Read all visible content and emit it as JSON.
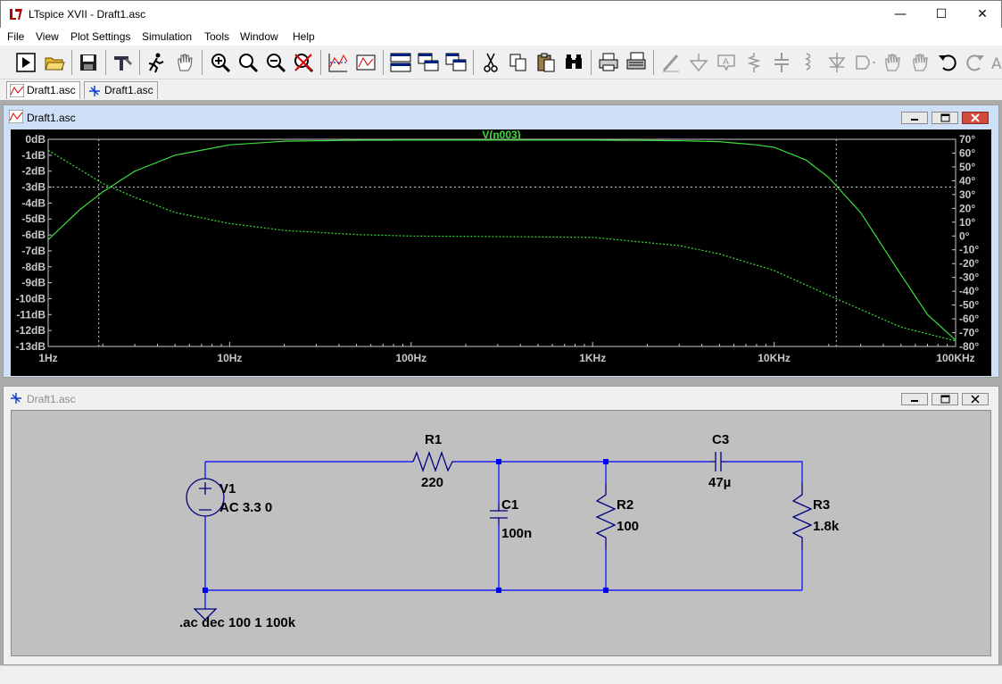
{
  "window": {
    "title": "LTspice XVII - Draft1.asc",
    "minimize_glyph": "—",
    "maximize_glyph": "☐",
    "close_glyph": "✕"
  },
  "menu": [
    "File",
    "View",
    "Plot Settings",
    "Simulation",
    "Tools",
    "Window",
    "Help"
  ],
  "toolbar_icons": [
    "run-icon",
    "open-icon",
    "save-icon",
    "control-panel-icon",
    "run-pause-icon",
    "pan-hand-icon",
    "zoom-in-icon",
    "zoom-fit-icon",
    "zoom-out-icon",
    "zoom-cancel-icon",
    "autorange-icon",
    "waveform-icon",
    "tile-horizontal-icon",
    "cascade-icon",
    "tile-vertical-icon",
    "cut-icon",
    "copy-icon",
    "paste-icon",
    "find-icon",
    "print-icon",
    "print-setup-icon",
    "wire-icon",
    "ground-icon",
    "label-icon",
    "resistor-icon",
    "capacitor-icon",
    "inductor-icon",
    "diode-icon",
    "component-icon",
    "move-icon",
    "drag-icon",
    "undo-icon",
    "redo-icon",
    "text-icon"
  ],
  "doc_tabs": [
    {
      "label": "Draft1.asc",
      "type": "waveform",
      "active": true
    },
    {
      "label": "Draft1.asc",
      "type": "schematic",
      "active": false
    }
  ],
  "plot_window": {
    "title": "Draft1.asc",
    "trace_label": "V(n003)",
    "trace_color": "#3cdc3c"
  },
  "chart_data": {
    "type": "line",
    "title": "",
    "trace": "V(n003)",
    "x_scale": "log",
    "xlim": [
      1,
      100000
    ],
    "x_ticks": [
      "1Hz",
      "10Hz",
      "100Hz",
      "1KHz",
      "10KHz",
      "100KHz"
    ],
    "y_left_ticks": [
      "0dB",
      "-1dB",
      "-2dB",
      "-3dB",
      "-4dB",
      "-5dB",
      "-6dB",
      "-7dB",
      "-8dB",
      "-9dB",
      "-10dB",
      "-11dB",
      "-12dB",
      "-13dB"
    ],
    "y_left_lim": [
      -13,
      0
    ],
    "y_right_ticks": [
      "70°",
      "60°",
      "50°",
      "40°",
      "30°",
      "20°",
      "10°",
      "0°",
      "-10°",
      "-20°",
      "-30°",
      "-40°",
      "-50°",
      "-60°",
      "-70°",
      "-80°"
    ],
    "y_right_lim": [
      -80,
      70
    ],
    "grid": false,
    "cursor_lines": {
      "x": [
        1.9,
        22000
      ],
      "y_db": -3
    },
    "series": [
      {
        "name": "magnitude",
        "axis": "left",
        "x": [
          1,
          1.5,
          2,
          3,
          5,
          10,
          20,
          50,
          100,
          1000,
          3000,
          5000,
          8000,
          10000,
          15000,
          20000,
          30000,
          50000,
          70000,
          100000
        ],
        "y": [
          -6.3,
          -4.4,
          -3.3,
          -2.0,
          -1.0,
          -0.35,
          -0.12,
          -0.06,
          -0.05,
          -0.05,
          -0.09,
          -0.15,
          -0.35,
          -0.5,
          -1.3,
          -2.4,
          -4.6,
          -8.5,
          -11.0,
          -12.6
        ]
      },
      {
        "name": "phase",
        "axis": "right",
        "x": [
          1,
          2,
          3,
          5,
          10,
          20,
          50,
          100,
          1000,
          3000,
          5000,
          10000,
          20000,
          50000,
          100000
        ],
        "y": [
          62,
          38,
          28,
          17,
          9,
          4,
          1,
          0,
          -1,
          -7,
          -13,
          -25,
          -43,
          -66,
          -76
        ]
      }
    ]
  },
  "schematic_window": {
    "title": "Draft1.asc",
    "components": {
      "V1": {
        "name": "V1",
        "value": "AC 3.3 0"
      },
      "R1": {
        "name": "R1",
        "value": "220"
      },
      "C1": {
        "name": "C1",
        "value": "100n"
      },
      "R2": {
        "name": "R2",
        "value": "100"
      },
      "C3": {
        "name": "C3",
        "value": "47µ"
      },
      "R3": {
        "name": "R3",
        "value": "1.8k"
      }
    },
    "directive": ".ac dec 100 1 100k",
    "wire_color": "#0000ff",
    "component_color": "#000080"
  }
}
